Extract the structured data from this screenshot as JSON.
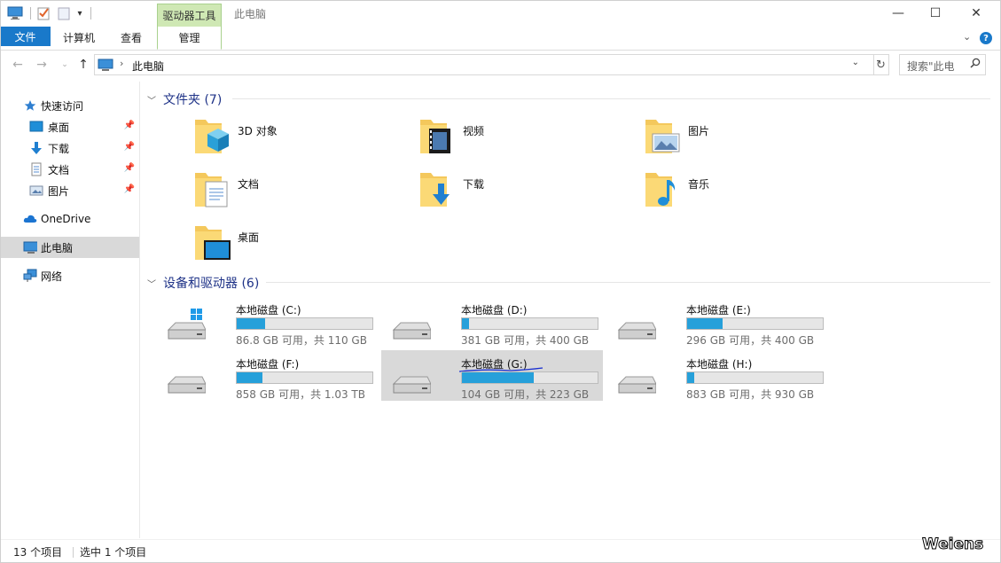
{
  "window": {
    "title": "此电脑",
    "context_tab_group": "驱动器工具",
    "minimize": "—",
    "maximize": "☐",
    "close": "✕"
  },
  "ribbon": {
    "tabs": [
      "文件",
      "计算机",
      "查看",
      "管理"
    ],
    "collapse_glyph": "⌄",
    "help": "?"
  },
  "address": {
    "crumb": "此电脑",
    "search_placeholder": "搜索\"此电"
  },
  "sidebar": {
    "quick_access": "快速访问",
    "quick_items": [
      "桌面",
      "下载",
      "文档",
      "图片"
    ],
    "onedrive": "OneDrive",
    "this_pc": "此电脑",
    "network": "网络"
  },
  "folders": {
    "heading": "文件夹 (7)",
    "items": [
      "3D 对象",
      "视频",
      "图片",
      "文档",
      "下载",
      "音乐",
      "桌面"
    ]
  },
  "drives": {
    "heading": "设备和驱动器 (6)",
    "items": [
      {
        "name": "本地磁盘 (C:)",
        "free": "86.8 GB 可用，共 110 GB",
        "used_fraction": 0.21
      },
      {
        "name": "本地磁盘 (D:)",
        "free": "381 GB 可用，共 400 GB",
        "used_fraction": 0.05
      },
      {
        "name": "本地磁盘 (E:)",
        "free": "296 GB 可用，共 400 GB",
        "used_fraction": 0.26
      },
      {
        "name": "本地磁盘 (F:)",
        "free": "858 GB 可用，共 1.03 TB",
        "used_fraction": 0.19
      },
      {
        "name": "本地磁盘 (G:)",
        "free": "104 GB 可用，共 223 GB",
        "used_fraction": 0.53
      },
      {
        "name": "本地磁盘 (H:)",
        "free": "883 GB 可用，共 930 GB",
        "used_fraction": 0.05
      }
    ]
  },
  "status": {
    "count": "13 个项目",
    "selected": "选中 1 个项目"
  },
  "watermark": "Weiens"
}
